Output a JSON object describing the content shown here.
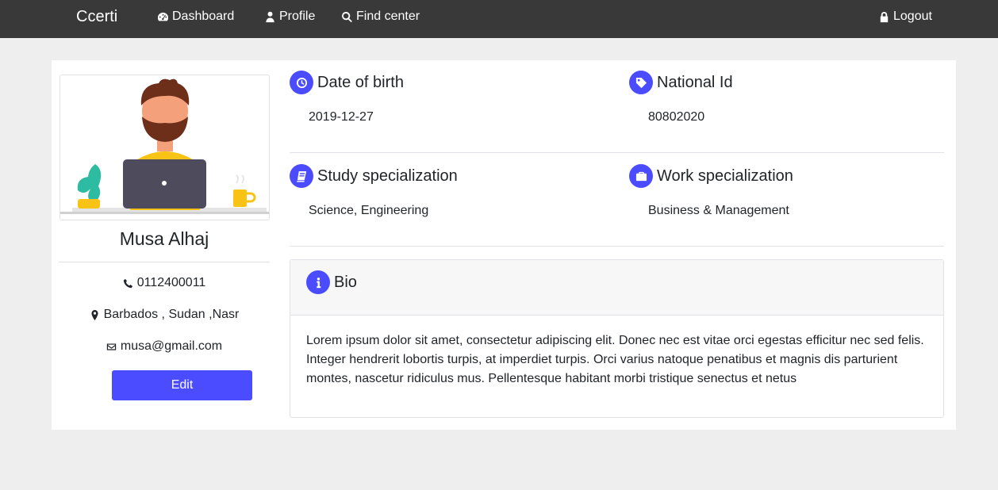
{
  "nav": {
    "brand": "Ccerti",
    "items": [
      {
        "label": "Dashboard",
        "icon": "dashboard-icon"
      },
      {
        "label": "Profile",
        "icon": "user-icon"
      },
      {
        "label": "Find center",
        "icon": "search-icon"
      }
    ],
    "logout": {
      "label": "Logout",
      "icon": "lock-icon"
    }
  },
  "profile": {
    "name": "Musa Alhaj",
    "phone": "0112400011",
    "location": "Barbados , Sudan ,Nasr",
    "email": "musa@gmail.com",
    "edit_label": "Edit"
  },
  "fields": {
    "dob": {
      "label": "Date of birth",
      "value": "2019-12-27",
      "icon": "clock-icon"
    },
    "national_id": {
      "label": "National Id",
      "value": "80802020",
      "icon": "tag-icon"
    },
    "study": {
      "label": "Study specialization",
      "value": "Science, Engineering",
      "icon": "book-icon"
    },
    "work": {
      "label": "Work specialization",
      "value": "Business & Management",
      "icon": "briefcase-icon"
    }
  },
  "bio": {
    "title": "Bio",
    "icon": "info-icon",
    "text": "Lorem ipsum dolor sit amet, consectetur adipiscing elit. Donec nec est vitae orci egestas efficitur nec sed felis. Integer hendrerit lobortis turpis, at imperdiet turpis. Orci varius natoque penatibus et magnis dis parturient montes, nascetur ridiculus mus. Pellentesque habitant morbi tristique senectus et netus"
  },
  "colors": {
    "accent": "#4b4bff",
    "navbar": "#393939",
    "background": "#eeeeee"
  }
}
